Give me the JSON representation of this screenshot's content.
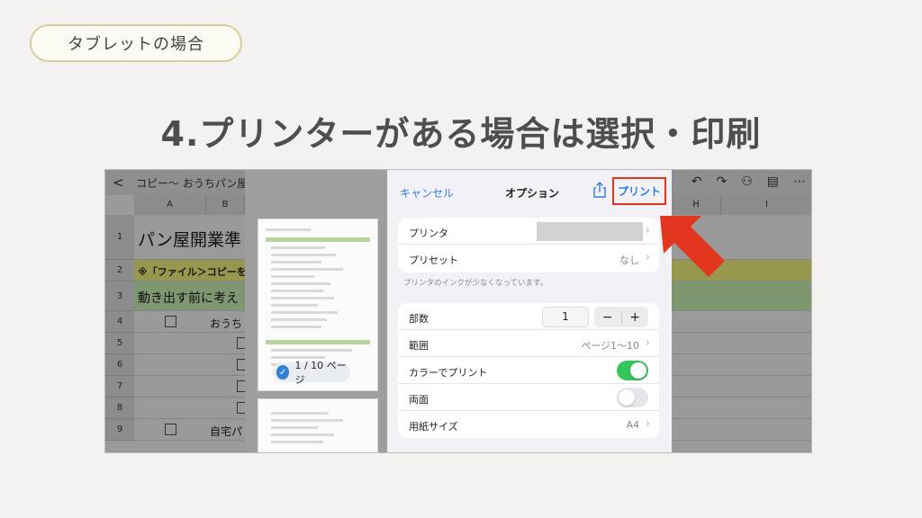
{
  "tag_label": "タブレットの場合",
  "headline": "4.プリンターがある場合は選択・印刷",
  "sheet": {
    "back": "<",
    "doc_title": "コピー〜 おうちパン屋",
    "columns": [
      "A",
      "B",
      "H",
      "I"
    ],
    "rows": [
      "1",
      "2",
      "3",
      "4",
      "5",
      "6",
      "7",
      "8",
      "9"
    ],
    "row1_text": "パン屋開業準",
    "row2_text": "※「ファイル＞コピーを",
    "row3_text": "動き出す前に考え",
    "row4_text": "おうち",
    "row9_text": "自宅パ"
  },
  "print_dialog": {
    "cancel": "キャンセル",
    "title": "オプション",
    "print": "プリント",
    "page_badge": "1 / 10 ページ",
    "printer_label": "プリンタ",
    "preset_label": "プリセット",
    "preset_value": "なし",
    "note": "プリンタのインクが少なくなっています。",
    "copies_label": "部数",
    "copies_value": "1",
    "stepper_minus": "−",
    "stepper_plus": "+",
    "range_label": "範囲",
    "range_value": "ページ1〜10",
    "color_label": "カラーでプリント",
    "color_on": true,
    "duplex_label": "両面",
    "duplex_on": false,
    "paper_label": "用紙サイズ",
    "paper_value": "A4"
  },
  "colors": {
    "accent_blue": "#2f7de0",
    "toggle_on": "#34c759",
    "highlight_red": "#e2361f"
  },
  "icons": [
    "chevron-left-icon",
    "undo-icon",
    "redo-icon",
    "add-user-icon",
    "comment-icon",
    "more-icon",
    "share-icon",
    "chevron-right-icon",
    "checkmark-icon",
    "arrow-icon"
  ]
}
